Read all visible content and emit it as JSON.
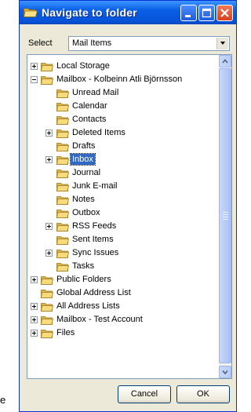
{
  "window": {
    "title": "Navigate to folder"
  },
  "select": {
    "label": "Select",
    "value": "Mail Items"
  },
  "tree": {
    "items": [
      {
        "label": "Local Storage",
        "level": 1,
        "expander": "plus"
      },
      {
        "label": "Mailbox - Kolbeinn Atli Björnsson",
        "level": 1,
        "expander": "minus"
      },
      {
        "label": "Unread Mail",
        "level": 2,
        "expander": "none"
      },
      {
        "label": "Calendar",
        "level": 2,
        "expander": "none"
      },
      {
        "label": "Contacts",
        "level": 2,
        "expander": "none"
      },
      {
        "label": "Deleted Items",
        "level": 2,
        "expander": "plus"
      },
      {
        "label": "Drafts",
        "level": 2,
        "expander": "none"
      },
      {
        "label": "Inbox",
        "level": 2,
        "expander": "plus",
        "selected": true
      },
      {
        "label": "Journal",
        "level": 2,
        "expander": "none"
      },
      {
        "label": "Junk E-mail",
        "level": 2,
        "expander": "none"
      },
      {
        "label": "Notes",
        "level": 2,
        "expander": "none"
      },
      {
        "label": "Outbox",
        "level": 2,
        "expander": "none"
      },
      {
        "label": "RSS Feeds",
        "level": 2,
        "expander": "plus"
      },
      {
        "label": "Sent Items",
        "level": 2,
        "expander": "none"
      },
      {
        "label": "Sync Issues",
        "level": 2,
        "expander": "plus"
      },
      {
        "label": "Tasks",
        "level": 2,
        "expander": "none"
      },
      {
        "label": "Public Folders",
        "level": 1,
        "expander": "plus"
      },
      {
        "label": "Global Address List",
        "level": 1,
        "expander": "none"
      },
      {
        "label": "All Address Lists",
        "level": 1,
        "expander": "plus"
      },
      {
        "label": "Mailbox - Test Account",
        "level": 1,
        "expander": "plus"
      },
      {
        "label": "Files",
        "level": 1,
        "expander": "plus"
      }
    ]
  },
  "buttons": {
    "cancel": "Cancel",
    "ok": "OK"
  },
  "side_letter": "e",
  "colors": {
    "title_bar": "#0a5fe4",
    "selection": "#316ac5",
    "folder": "#f6d574"
  }
}
